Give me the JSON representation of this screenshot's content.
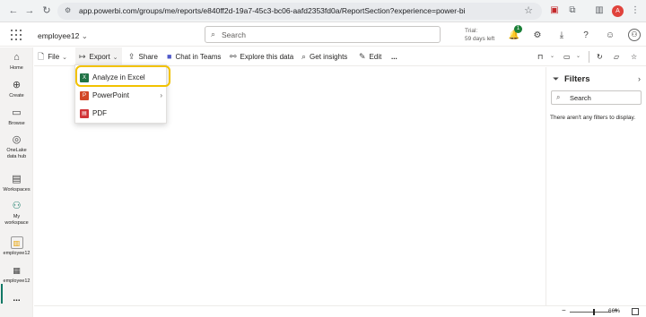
{
  "browser": {
    "url": "app.powerbi.com/groups/me/reports/e840ff2d-19a7-45c3-bc06-aafd2353fd0a/ReportSection?experience=power-bi",
    "avatar_letter": "A"
  },
  "header": {
    "workspace_name": "employee12",
    "search_placeholder": "Search",
    "trial_line1": "Trial:",
    "trial_line2": "59 days left",
    "notification_count": "1"
  },
  "rail": {
    "items": [
      {
        "label": "Home"
      },
      {
        "label": "Create"
      },
      {
        "label": "Browse"
      },
      {
        "label_line1": "OneLake",
        "label_line2": "data hub"
      },
      {
        "label": "Workspaces"
      },
      {
        "label_line1": "My",
        "label_line2": "workspace"
      },
      {
        "label": "employee12"
      },
      {
        "label": "employee12"
      },
      {
        "label": "..."
      }
    ]
  },
  "toolbar": {
    "file": "File",
    "export": "Export",
    "share": "Share",
    "chat": "Chat in Teams",
    "explore": "Explore this data",
    "insights": "Get insights",
    "edit": "Edit",
    "more": "..."
  },
  "export_menu": {
    "items": [
      {
        "label": "Analyze in Excel",
        "icon": "excel-icon",
        "color": "#217346"
      },
      {
        "label": "PowerPoint",
        "icon": "powerpoint-icon",
        "color": "#d24726"
      },
      {
        "label": "PDF",
        "icon": "pdf-icon",
        "color": "#d13438"
      }
    ]
  },
  "filters": {
    "title": "Filters",
    "search_placeholder": "Search",
    "empty_text": "There aren't any filters to display."
  },
  "status": {
    "zoom": "66%"
  },
  "colors": {
    "highlight": "#f2c200",
    "accent": "#117865"
  }
}
